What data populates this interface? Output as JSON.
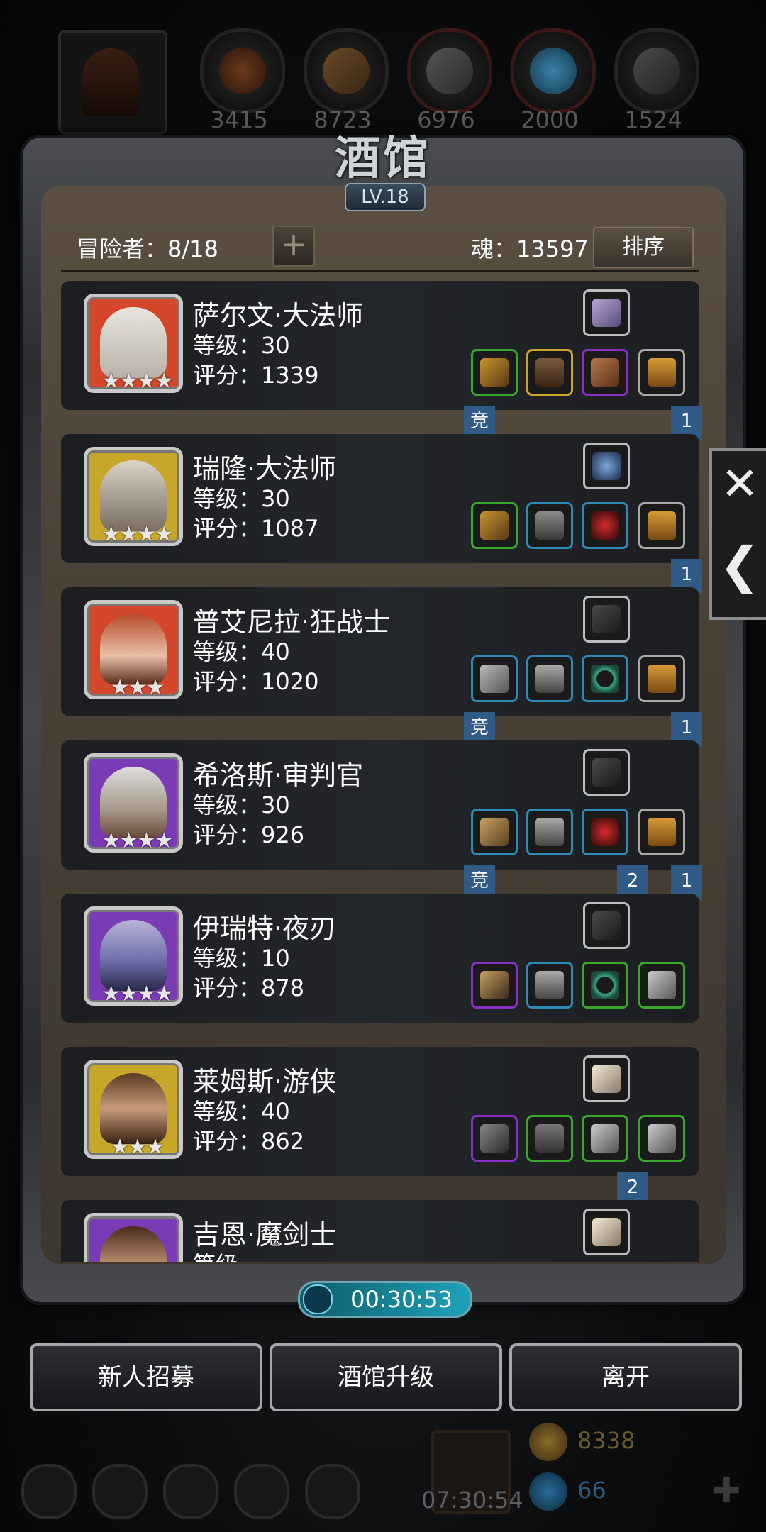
{
  "resources": {
    "values": [
      "3415",
      "8723",
      "6976",
      "2000",
      "1524"
    ]
  },
  "tavern": {
    "title": "酒馆",
    "level": "LV.18",
    "adventurers": "冒险者：8/18",
    "plus": "+",
    "soul": "魂：13597",
    "sort_label": "排序"
  },
  "heroes": [
    {
      "name": "萨尔文·大法师",
      "level": "等级：30",
      "score": "评分：1339",
      "stars": "★★★★",
      "frame": "#d4472b",
      "flags": [
        "竞",
        "1"
      ]
    },
    {
      "name": "瑞隆·大法师",
      "level": "等级：30",
      "score": "评分：1087",
      "stars": "★★★★",
      "frame": "#c8a62a",
      "flags": [
        "",
        "1"
      ]
    },
    {
      "name": "普艾尼拉·狂战士",
      "level": "等级：40",
      "score": "评分：1020",
      "stars": "★★★",
      "frame": "#d4472b",
      "flags": [
        "竞",
        "1"
      ]
    },
    {
      "name": "希洛斯·审判官",
      "level": "等级：30",
      "score": "评分：926",
      "stars": "★★★★",
      "frame": "#7a3bb4",
      "flags": [
        "竞",
        "2",
        "1"
      ]
    },
    {
      "name": "伊瑞特·夜刃",
      "level": "等级：10",
      "score": "评分：878",
      "stars": "★★★★",
      "frame": "#7a3bb4",
      "flags": []
    },
    {
      "name": "莱姆斯·游侠",
      "level": "等级：40",
      "score": "评分：862",
      "stars": "★★★",
      "frame": "#c8a62a",
      "flags": [
        "2"
      ]
    },
    {
      "name": "吉恩·魔剑士",
      "level": "等级",
      "score": "",
      "stars": "",
      "frame": "#7a3bb4",
      "flags": []
    }
  ],
  "side_tab": {
    "close": "✕",
    "back": "❮"
  },
  "timer": "00:30:53",
  "buttons": {
    "recruit": "新人招募",
    "upgrade": "酒馆升级",
    "leave": "离开"
  },
  "dock": {
    "gift_timer": "07:30:54",
    "gold": "8338",
    "gems": "66",
    "add": "✚"
  },
  "colors": {
    "rarity_green": "#3aa62e",
    "rarity_gold": "#c8a62a",
    "rarity_purple": "#8a2fc2",
    "rarity_blue": "#2d8ab8",
    "flag_blue": "#2f5b86"
  }
}
